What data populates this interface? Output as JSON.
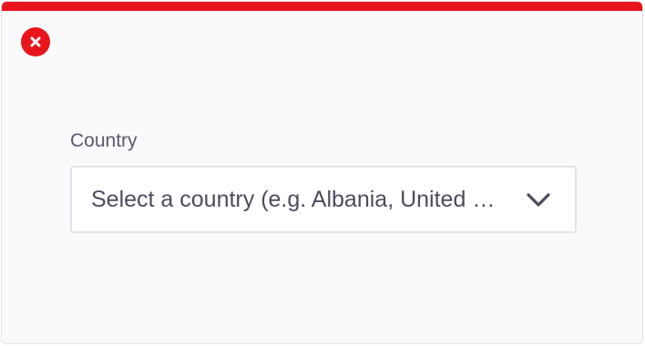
{
  "form": {
    "country_label": "Country",
    "country_select": {
      "placeholder": "Select a country (e.g. Albania, United States)",
      "selected_value": ""
    }
  },
  "status": {
    "state": "error",
    "icon": "close-icon",
    "color": "#e8151b"
  },
  "icons": {
    "dropdown": "chevron-down-icon"
  }
}
